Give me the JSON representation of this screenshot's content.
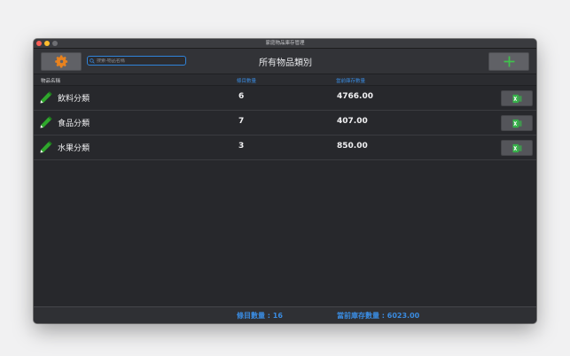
{
  "window": {
    "title": "家庭物品庫存管理"
  },
  "toolbar": {
    "settings_icon": "gear-icon",
    "search_placeholder": "搜索-物品名稱",
    "title": "所有物品類別",
    "add_icon": "plus-icon"
  },
  "table": {
    "headers": {
      "name": "物品名稱",
      "count": "條目數量",
      "stock": "當前庫存數量"
    },
    "rows": [
      {
        "name": "飲料分類",
        "count": "6",
        "stock": "4766.00"
      },
      {
        "name": "食品分類",
        "count": "7",
        "stock": "407.00"
      },
      {
        "name": "水果分類",
        "count": "3",
        "stock": "850.00"
      }
    ]
  },
  "footer": {
    "total_count": "條目數量 : 16",
    "total_stock": "當前庫存數量 : 6023.00"
  },
  "colors": {
    "accent": "#3a8be0",
    "gear": "#e8821e",
    "add": "#3fc24d",
    "pencil": "#2fa82c",
    "excel": "#37b24a"
  }
}
